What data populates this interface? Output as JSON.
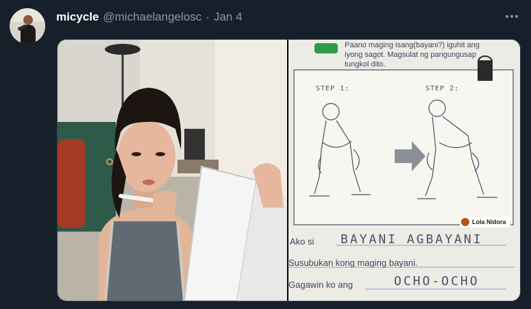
{
  "tweet": {
    "display_name": "micycle",
    "handle": "@michaelangelosc",
    "separator": "·",
    "date": "Jan 4"
  },
  "media": {
    "left_photo": {
      "description_icon": "photo-icon"
    },
    "worksheet": {
      "instruction_line1": "Paano maging isang(bayani?) iguhit ang",
      "instruction_line2": "iyong sagot. Magsulat ng pangungusap",
      "instruction_line3": "tungkol dito.",
      "step1": "STEP 1:",
      "step2": "STEP 2:",
      "watermark": "Lola Nidora",
      "sentence1_label": "Ako si",
      "sentence1_answer": "BAYANI AGBAYANI",
      "sentence2": "Susubukan kong maging bayani.",
      "sentence3_label": "Gagawin ko ang",
      "sentence3_answer": "OCHO-OCHO"
    }
  },
  "colors": {
    "background": "#15202b",
    "handle_gray": "#8b98a5",
    "name_white": "#ffffff"
  }
}
